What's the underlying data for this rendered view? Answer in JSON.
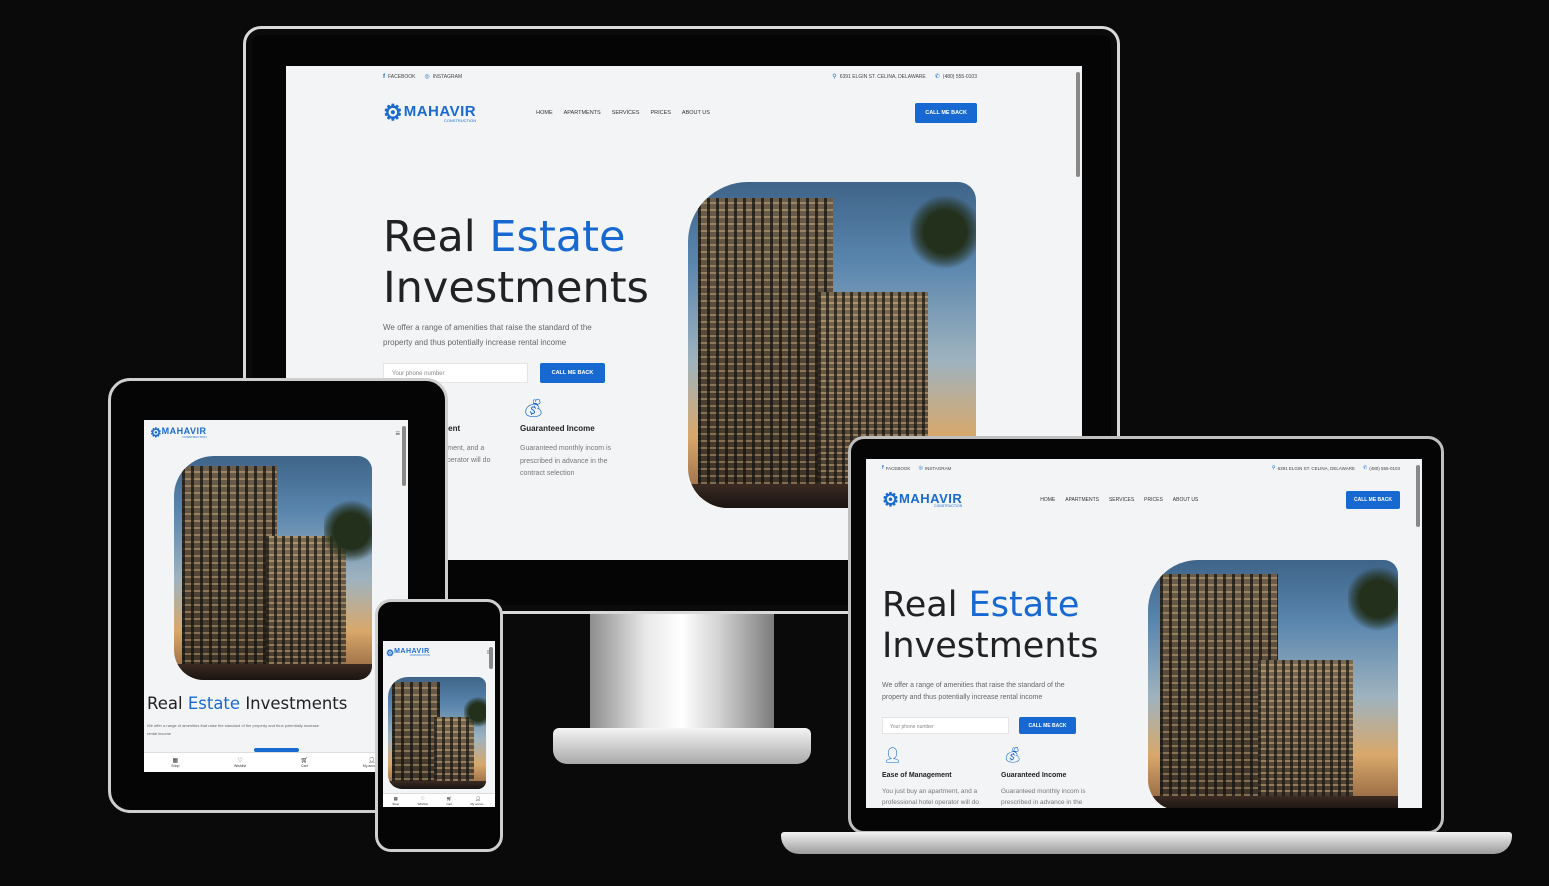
{
  "site": {
    "topbar": {
      "facebook": "FACEBOOK",
      "instagram": "INSTAGRAM",
      "address": "6391 ELGIN ST. CELINA, DELAWARE",
      "phone": "(480) 555-0103"
    },
    "logo": {
      "name": "MAHAVIR",
      "sub": "CONSTRUCTION"
    },
    "nav": [
      "HOME",
      "APARTMENTS",
      "SERVICES",
      "PRICES",
      "ABOUT US"
    ],
    "call_button": "CALL ME BACK",
    "hero": {
      "title_1": "Real",
      "title_accent": "Estate",
      "title_2": "Investments",
      "description": "We offer a range of amenities that raise the standard of the property and thus potentially increase rental income",
      "phone_placeholder": "Your phone number",
      "cta": "CALL ME BACK"
    },
    "features": [
      {
        "title": "Ease of Management",
        "text": "You just buy an apartment, and a professional hotel operator will do"
      },
      {
        "title": "Guaranteed Income",
        "text": "Guaranteed monthly incom is prescribed in advance in the contract selection"
      }
    ],
    "desktop_feature_partial": {
      "title": "ment",
      "text_1": "rtment, and a",
      "text_2": "operator will do"
    },
    "bottom_nav": [
      "Shop",
      "Wishlist",
      "Cart",
      "My accou..."
    ]
  },
  "colors": {
    "accent": "#1769d1",
    "background": "#0a0a0a",
    "page": "#f3f4f6"
  },
  "icons": {
    "facebook": "facebook-icon",
    "instagram": "instagram-icon",
    "location": "location-icon",
    "phone": "phone-icon",
    "menu": "hamburger-menu-icon",
    "manager": "manager-icon",
    "income": "money-bag-icon"
  }
}
